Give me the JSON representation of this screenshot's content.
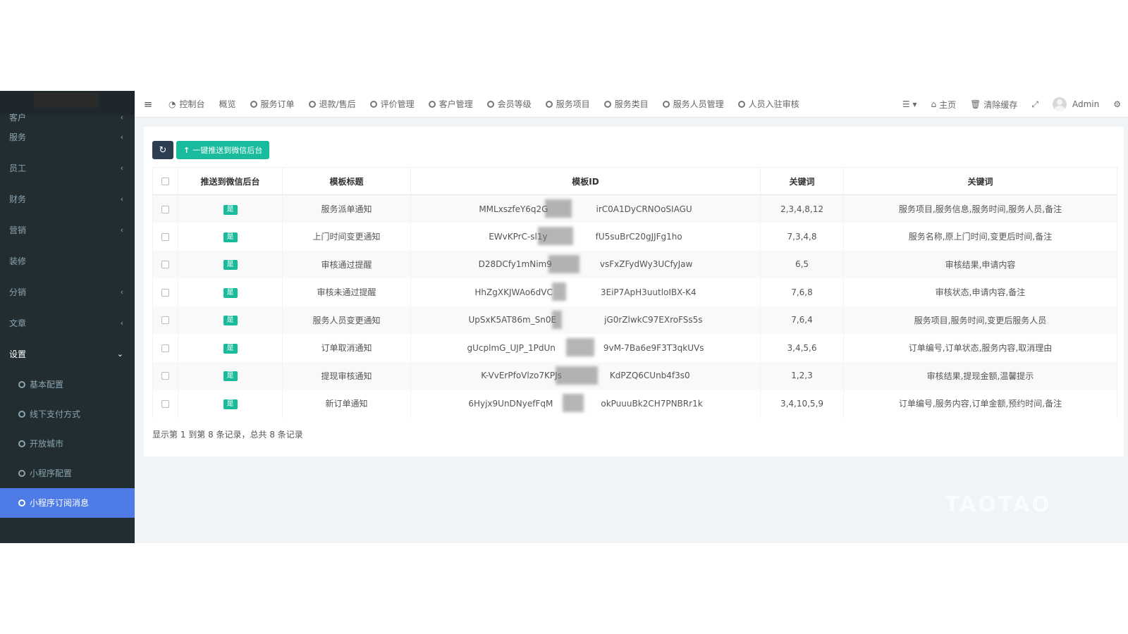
{
  "sidebar": {
    "partial_top": "客户",
    "groups": [
      "服务",
      "员工",
      "财务",
      "营销",
      "装修",
      "分销",
      "文章"
    ],
    "open_group": "设置",
    "sub_items": [
      "基本配置",
      "线下支付方式",
      "开放城市",
      "小程序配置",
      "小程序订阅消息"
    ],
    "active_sub": "小程序订阅消息"
  },
  "topnav": {
    "toggle_icon": "hamburger-icon",
    "tabs": [
      "控制台",
      "概览",
      "服务订单",
      "退款/售后",
      "评价管理",
      "客户管理",
      "会员等级",
      "服务项目",
      "服务类目",
      "服务人员管理",
      "人员入驻审核"
    ],
    "home": "主页",
    "clear_cache": "清除缓存",
    "user": "Admin"
  },
  "toolbar": {
    "push_label": "一键推送到微信后台"
  },
  "table": {
    "headers": [
      "推送到微信后台",
      "模板标题",
      "模板ID",
      "关键词",
      "关键词"
    ],
    "rows": [
      {
        "push": "是",
        "title": "服务派单通知",
        "id_left": "MMLxszfeY6q2G",
        "id_right": "irC0A1DyCRNOoSIAGU",
        "kw_ids": "2,3,4,8,12",
        "keywords": "服务项目,服务信息,服务时间,服务人员,备注"
      },
      {
        "push": "是",
        "title": "上门时间变更通知",
        "id_left": "EWvKPrC-sl1y",
        "id_right": "fU5suBrC20gJJFg1ho",
        "kw_ids": "7,3,4,8",
        "keywords": "服务名称,原上门时间,变更后时间,备注"
      },
      {
        "push": "是",
        "title": "审核通过提醒",
        "id_left": "D28DCfy1mNim9",
        "id_right": "vsFxZFydWy3UCfyJaw",
        "kw_ids": "6,5",
        "keywords": "审核结果,申请内容"
      },
      {
        "push": "是",
        "title": "审核未通过提醒",
        "id_left": "HhZgXKJWAo6dVC",
        "id_right": "3EiP7ApH3uutloIBX-K4",
        "kw_ids": "7,6,8",
        "keywords": "审核状态,申请内容,备注"
      },
      {
        "push": "是",
        "title": "服务人员变更通知",
        "id_left": "UpSxK5AT86m_Sn0E",
        "id_right": "jG0rZlwkC97EXroFSs5s",
        "kw_ids": "7,6,4",
        "keywords": "服务项目,服务时间,变更后服务人员"
      },
      {
        "push": "是",
        "title": "订单取消通知",
        "id_left": "gUcplmG_UJP_1PdUn",
        "id_right": "9vM-7Ba6e9F3T3qkUVs",
        "kw_ids": "3,4,5,6",
        "keywords": "订单编号,订单状态,服务内容,取消理由"
      },
      {
        "push": "是",
        "title": "提现审核通知",
        "id_left": "K-VvErPfoVlzo7KPJs",
        "id_right": "KdPZQ6CUnb4f3s0",
        "kw_ids": "1,2,3",
        "keywords": "审核结果,提现金额,温馨提示"
      },
      {
        "push": "是",
        "title": "新订单通知",
        "id_left": "6Hyjx9UnDNyefFqM",
        "id_right": "okPuuuBk2CH7PNBRr1k",
        "kw_ids": "3,4,10,5,9",
        "keywords": "订单编号,服务内容,订单金额,预约时间,备注"
      }
    ]
  },
  "pager": {
    "info": "显示第 1 到第 8 条记录，总共 8 条记录"
  },
  "watermark": "TAOTAO"
}
